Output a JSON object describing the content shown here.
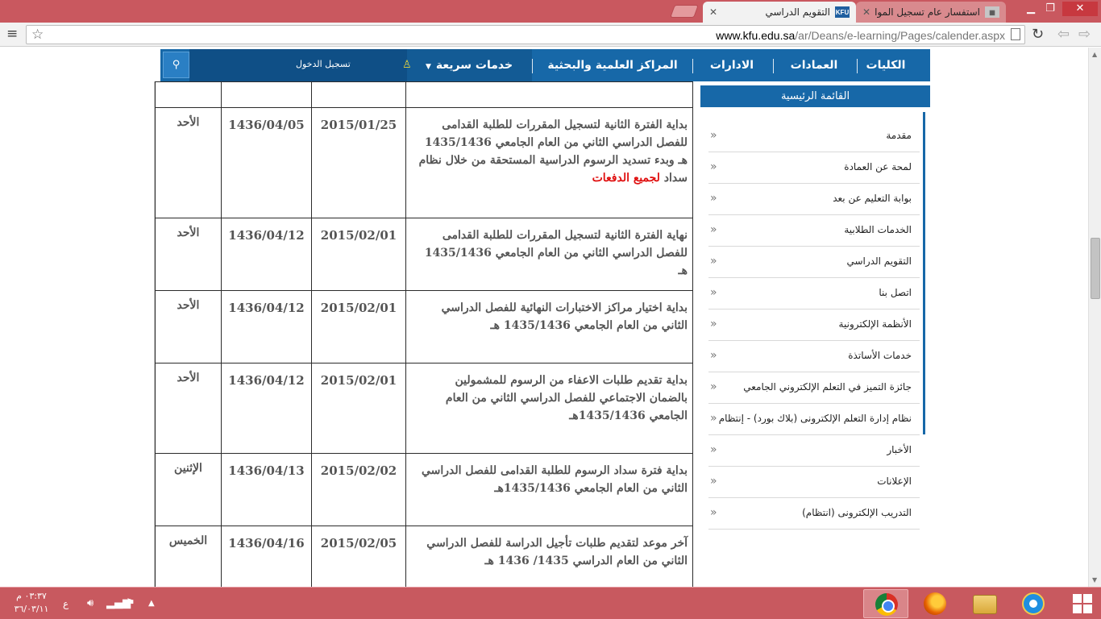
{
  "browser": {
    "tabs": [
      {
        "title": "التقويم الدراسي",
        "favicon": "KFU",
        "active": true
      },
      {
        "title": "استفسار عام تسجيل المواد -",
        "favicon": "",
        "active": false
      }
    ],
    "url_host": "www.kfu.edu.sa",
    "url_path": "/ar/Deans/e-learning/Pages/calender.aspx"
  },
  "nav": {
    "items": [
      "الكليات",
      "العمادات",
      "الادارات",
      "المراكز العلمية والبحثية",
      "خدمات سريعة"
    ],
    "login": "تسجيل الدخول"
  },
  "sidebar": {
    "title": "القائمة الرئيسية",
    "items": [
      "مقدمة",
      "لمحة عن العمادة",
      "بوابة التعليم عن بعد",
      "الخدمات الطلابية",
      "التقويم الدراسي",
      "اتصل بنا",
      "الأنظمة الإلكترونية",
      "خدمات الأساتذة",
      "جائزة التميز في التعلم الإلكتروني الجامعي",
      "نظام إدارة التعلم الإلكترونى (بلاك بورد) - إنتظام",
      "الأخبار",
      "الإعلانات",
      "التدريب الإلكترونى (انتظام)"
    ]
  },
  "calendar": {
    "rows": [
      {
        "desc": "بداية الفترة الثانية لتسجيل المقررات للطلبة القدامى للفصل الدراسي الثاني من العام الجامعي 1435/1436 هـ وبدء تسديد الرسوم الدراسية المستحقة من خلال نظام سداد",
        "desc_red": "لجميع الدفعات",
        "greg": "2015/01/25",
        "hijri": "1436/04/05",
        "day": "الأحد"
      },
      {
        "desc": "نهاية الفترة الثانية لتسجيل المقررات للطلبة القدامى للفصل الدراسي الثاني من العام الجامعي 1435/1436 هـ",
        "desc_red": "",
        "greg": "2015/02/01",
        "hijri": "1436/04/12",
        "day": "الأحد"
      },
      {
        "desc": "بداية اختيار مراكز الاختبارات النهائية للفصل الدراسي الثاني من العام الجامعي 1435/1436 هـ",
        "desc_red": "",
        "greg": "2015/02/01",
        "hijri": "1436/04/12",
        "day": "الأحد"
      },
      {
        "desc": "بداية تقديم طلبات الاعفاء من الرسوم للمشمولين بالضمان الاجتماعي للفصل الدراسي الثاني من العام الجامعي 1435/1436هـ",
        "desc_red": "",
        "greg": "2015/02/01",
        "hijri": "1436/04/12",
        "day": "الأحد"
      },
      {
        "desc": "بداية فترة سداد الرسوم للطلبة القدامى للفصل الدراسي الثاني من العام الجامعي 1435/1436هـ",
        "desc_red": "",
        "greg": "2015/02/02",
        "hijri": "1436/04/13",
        "day": "الإثنين"
      },
      {
        "desc": "آخر موعد لتقديم طلبات تأجيل الدراسة للفصل الدراسي الثاني من العام الدراسي 1435/ 1436 هـ",
        "desc_red": "",
        "greg": "2015/02/05",
        "hijri": "1436/04/16",
        "day": "الخميس"
      }
    ]
  },
  "taskbar": {
    "time": "٠٣:٣٧ م",
    "date": "٣٦/٠٣/١١",
    "lang": "ع"
  },
  "icons": {
    "menu": "hamburger-icon",
    "star": "star-icon",
    "search": "search-icon",
    "user": "user-icon",
    "chevron": "double-chevron-left-icon"
  },
  "colors": {
    "nav_blue": "#1768a8",
    "chrome_red": "#c9585f",
    "link_red": "#e01010"
  }
}
